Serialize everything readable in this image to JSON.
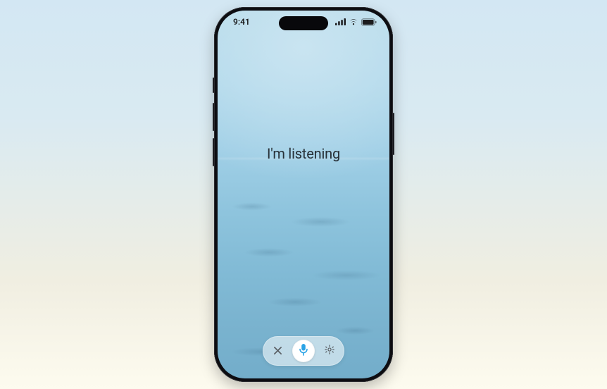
{
  "status_bar": {
    "time": "9:41",
    "icons": {
      "cellular": "cellular-signal-icon",
      "wifi": "wifi-icon",
      "battery": "battery-icon"
    }
  },
  "prompt": {
    "text": "I'm listening"
  },
  "controls": {
    "close": {
      "name": "close-icon"
    },
    "mic": {
      "name": "microphone-icon"
    },
    "settings": {
      "name": "gear-icon"
    }
  },
  "colors": {
    "accent": "#2aa3e6"
  }
}
